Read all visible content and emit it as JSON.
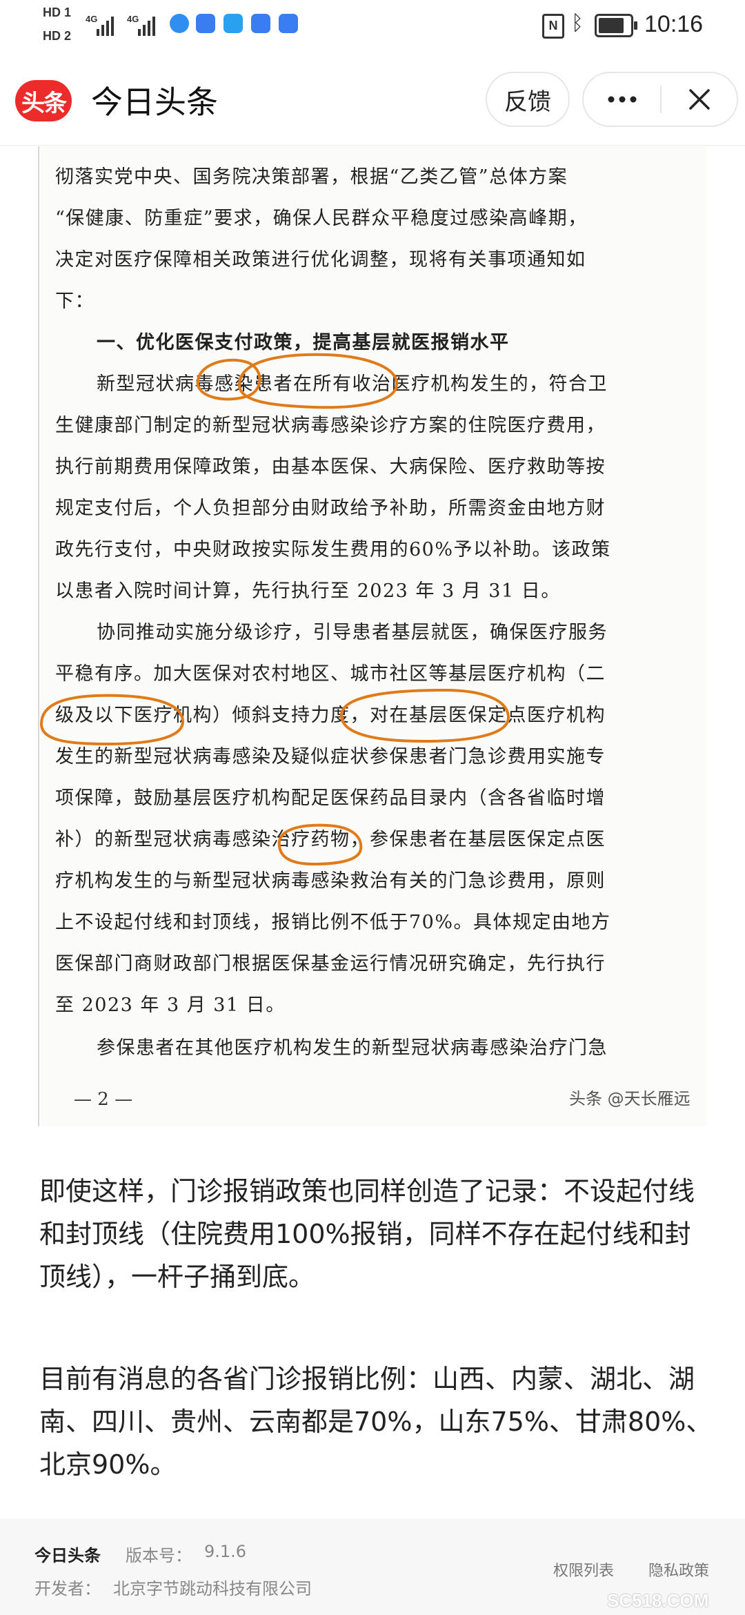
{
  "status_bar": {
    "sim1": "HD 1",
    "sim2": "HD 2",
    "net1": "4G",
    "net2": "4G",
    "time": "10:16"
  },
  "header": {
    "logo_text": "头条",
    "title": "今日头条",
    "feedback_label": "反馈",
    "more_icon": "more-horizontal-icon",
    "close_icon": "close-icon",
    "accent_color": "#ec2b2b"
  },
  "doc_image": {
    "lines": [
      "彻落实党中央、国务院决策部署，根据“乙类乙管”总体方案",
      "“保健康、防重症”要求，确保人民群众平稳度过感染高峰期，",
      "决定对医疗保障相关政策进行优化调整，现将有关事项通知如",
      "下：",
      "一、优化医保支付政策，提高基层就医报销水平",
      "新型冠状病毒感染患者在所有收治医疗机构发生的，符合卫",
      "生健康部门制定的新型冠状病毒感染诊疗方案的住院医疗费用，",
      "执行前期费用保障政策，由基本医保、大病保险、医疗救助等按",
      "规定支付后，个人负担部分由财政给予补助，所需资金由地方财",
      "政先行支付，中央财政按实际发生费用的60%予以补助。该政策",
      "以患者入院时间计算，先行执行至 2023 年 3 月 31 日。",
      "协同推动实施分级诊疗，引导患者基层就医，确保医疗服务",
      "平稳有序。加大医保对农村地区、城市社区等基层医疗机构（二",
      "级及以下医疗机构）倾斜支持力度，对在基层医保定点医疗机构",
      "发生的新型冠状病毒感染及疑似症状参保患者门急诊费用实施专",
      "项保障，鼓励基层医疗机构配足医保药品目录内（含各省临时增",
      "补）的新型冠状病毒感染治疗药物，参保患者在基层医保定点医",
      "疗机构发生的与新型冠状病毒感染救治有关的门急诊费用，原则",
      "上不设起付线和封顶线，报销比例不低于70%。具体规定由地方",
      "医保部门商财政部门根据医保基金运行情况研究确定，先行执行",
      "至 2023 年 3 月 31 日。",
      "参保患者在其他医疗机构发生的新型冠状病毒感染治疗门急"
    ],
    "page_number": "— 2 —",
    "watermark": "头条 @天长雁远",
    "highlight_color": "#e07b1a"
  },
  "article": {
    "para1": "即使这样，门诊报销政策也同样创造了记录：不设起付线和封顶线（住院费用100%报销，同样不存在起付线和封顶线），一杆子捅到底。",
    "para2": "目前有消息的各省门诊报销比例：山西、内蒙、湖北、湖南、四川、贵州、云南都是70%，山东75%、甘肃80%、北京90%。"
  },
  "footer": {
    "app_name": "今日头条",
    "version_label": "版本号：",
    "version": "9.1.6",
    "developer_label": "开发者：",
    "developer": "北京字节跳动科技有限公司",
    "permissions_link": "权限列表",
    "privacy_link": "隐私政策",
    "watermark": "SC518.COM"
  }
}
